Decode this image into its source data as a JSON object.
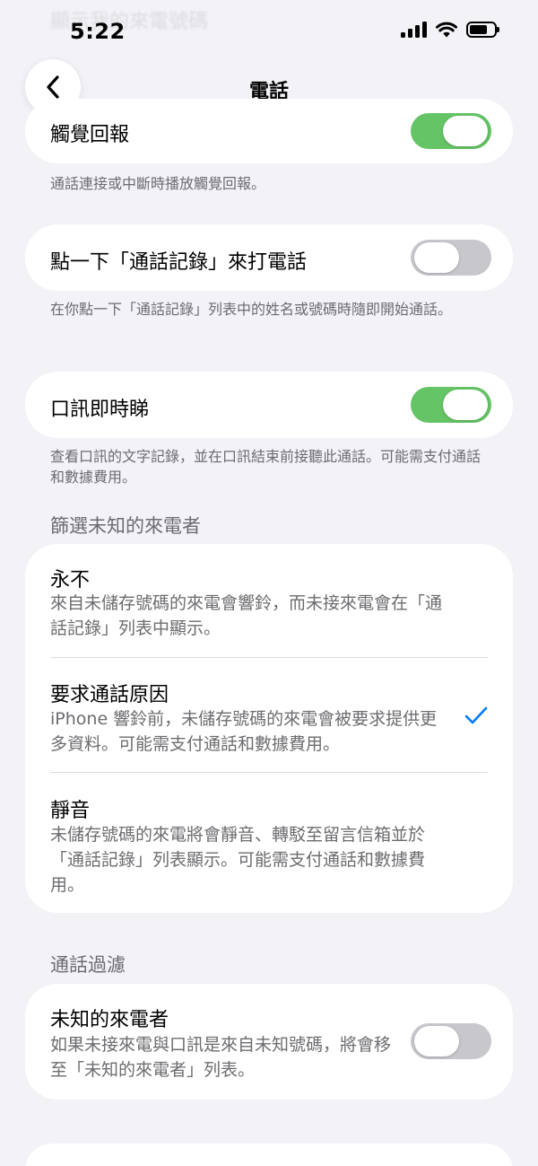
{
  "ghost_text": "顯示我的來電號碼",
  "status_bar": {
    "time": "5:22"
  },
  "nav": {
    "title": "電話"
  },
  "haptics": {
    "label": "觸覺回報",
    "enabled": true,
    "footnote": "通話連接或中斷時播放觸覺回報。"
  },
  "tap_to_call": {
    "label": "點一下「通話記錄」來打電話",
    "enabled": false,
    "footnote": "在你點一下「通話記錄」列表中的姓名或號碼時隨即開始通話。"
  },
  "live_voicemail": {
    "label": "口訊即時睇",
    "enabled": true,
    "footnote": "查看口訊的文字記錄，並在口訊結束前接聽此通話。可能需支付通話和數據費用。"
  },
  "screen_unknown": {
    "header": "篩選未知的來電者",
    "options": [
      {
        "title": "永不",
        "desc": "來自未儲存號碼的來電會響鈴，而未接來電會在「通話記錄」列表中顯示。",
        "selected": false
      },
      {
        "title": "要求通話原因",
        "desc": "iPhone 響鈴前，未儲存號碼的來電會被要求提供更多資料。可能需支付通話和數據費用。",
        "selected": true
      },
      {
        "title": "靜音",
        "desc": "未儲存號碼的來電將會靜音、轉駁至留言信箱並於「通話記錄」列表顯示。可能需支付通話和數據費用。",
        "selected": false
      }
    ]
  },
  "call_filtering": {
    "header": "通話過濾",
    "title": "未知的來電者",
    "desc": "如果未接來電與口訊是來自未知號碼，將會移至「未知的來電者」列表。",
    "enabled": false
  },
  "colors": {
    "accent": "#007aff",
    "toggle_on": "#65c466",
    "toggle_off": "#c7c7cc"
  }
}
